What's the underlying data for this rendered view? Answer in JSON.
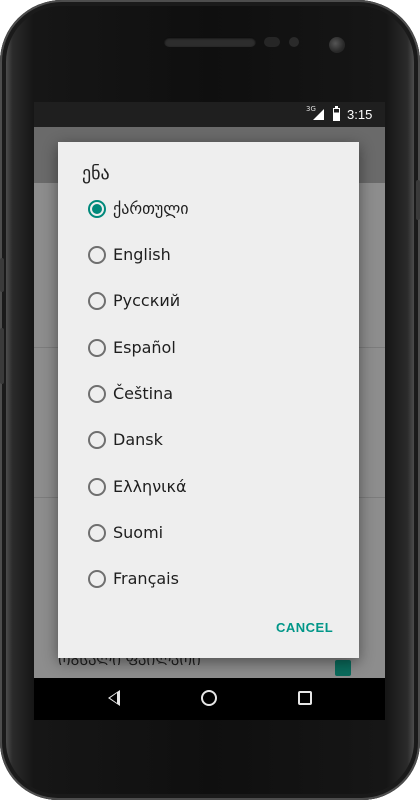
{
  "status_bar": {
    "network": "3G",
    "time": "3:15"
  },
  "background": {
    "bottom_label": "ᲝᲒᲡᲐᲚᲘ ᲤᲐᲘᲚᲐᲝᲘ"
  },
  "dialog": {
    "title": "ენა",
    "selected_index": 0,
    "options": [
      {
        "label": "ქართული",
        "checked": true
      },
      {
        "label": "English",
        "checked": false
      },
      {
        "label": "Русский",
        "checked": false
      },
      {
        "label": "Español",
        "checked": false
      },
      {
        "label": "Čeština",
        "checked": false
      },
      {
        "label": "Dansk",
        "checked": false
      },
      {
        "label": "Ελληνικά",
        "checked": false
      },
      {
        "label": "Suomi",
        "checked": false
      },
      {
        "label": "Français",
        "checked": false
      }
    ],
    "cancel_label": "CANCEL"
  },
  "colors": {
    "accent": "#009688",
    "dialog_bg": "#eeeeee"
  },
  "icons": {
    "back": "back-triangle-icon",
    "home": "home-circle-icon",
    "recents": "recents-square-icon"
  }
}
